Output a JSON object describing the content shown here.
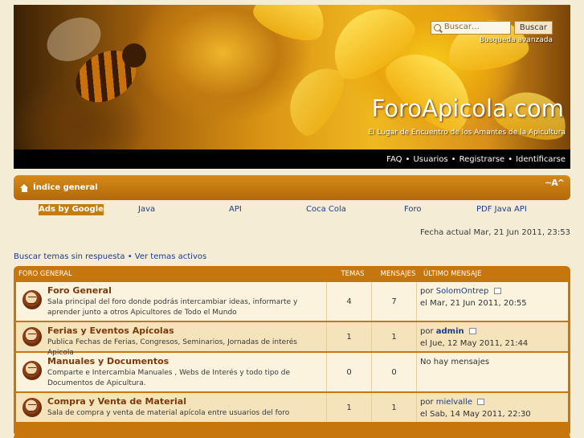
{
  "header": {
    "site_title": "ForoApicola.com",
    "site_description": "El Lugar de Encuentro de los Amantes de la Apicultura",
    "search_placeholder": "Buscar…",
    "search_button": "Buscar",
    "advanced_search": "Busqueda avanzada"
  },
  "topnav": {
    "items": [
      "FAQ",
      "Usuarios",
      "Registrarse",
      "Identificarse"
    ],
    "separator": "•"
  },
  "breadcrumb": {
    "home": "Índice general",
    "font_size_control": "~A^"
  },
  "ads": {
    "label": "Ads by Google",
    "links": [
      "Java",
      "API",
      "Coca Cola",
      "Foro",
      "PDF Java API"
    ]
  },
  "current_date": "Fecha actual Mar, 21 Jun 2011, 23:53",
  "quick_links": {
    "unanswered": "Buscar temas sin respuesta",
    "separator": "•",
    "active": "Ver temas activos"
  },
  "forum_table": {
    "category": "FORO GENERAL",
    "col_topics": "TEMAS",
    "col_posts": "MENSAJES",
    "col_last": "ÚLTIMO MENSAJE",
    "forums": [
      {
        "title": "Foro General",
        "description": "Sala principal del foro donde podrás intercambiar ideas, informarte y aprender junto a otros Apicultores de Todo el Mundo",
        "topics": "4",
        "posts": "7",
        "last_by": "por",
        "last_user": "SolomOntrep",
        "last_date": "el Mar, 21 Jun 2011, 20:55"
      },
      {
        "title": "Ferias y Eventos Apícolas",
        "description": "Publica Fechas de Ferias, Congresos, Seminarios, Jornadas de interés Apicola",
        "topics": "1",
        "posts": "1",
        "last_by": "por",
        "last_user": "admin",
        "last_date": "el Jue, 12 May 2011, 21:44"
      },
      {
        "title": "Manuales y Documentos",
        "description": "Comparte e Intercambia Manuales , Webs de Interés y todo tipo de Documentos de Apicultura.",
        "topics": "0",
        "posts": "0",
        "last_none": "No hay mensajes"
      },
      {
        "title": "Compra y Venta de Material",
        "description": "Sala de compra y venta de material apícola entre usuarios del foro",
        "topics": "1",
        "posts": "1",
        "last_by": "por",
        "last_user": "mielvalle",
        "last_date": "el Sab, 14 May 2011, 22:30"
      }
    ]
  },
  "colors": {
    "accent": "#c7760e",
    "link": "#1a3d8a",
    "forum_title": "#7a3a0a",
    "admin": "#aa0000"
  }
}
